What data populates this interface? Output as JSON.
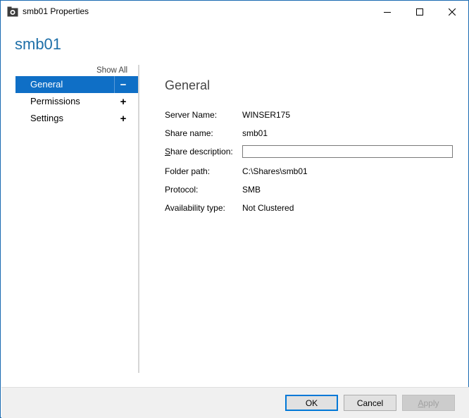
{
  "window": {
    "title": "smb01 Properties"
  },
  "header": {
    "title": "smb01"
  },
  "nav": {
    "show_all": "Show All",
    "items": [
      {
        "label": "General",
        "toggle": "−",
        "selected": true
      },
      {
        "label": "Permissions",
        "toggle": "+",
        "selected": false
      },
      {
        "label": "Settings",
        "toggle": "+",
        "selected": false
      }
    ]
  },
  "general": {
    "section_title": "General",
    "fields": {
      "server_name": {
        "label": "Server Name:",
        "value": "WINSER175"
      },
      "share_name": {
        "label": "Share name:",
        "value": "smb01"
      },
      "share_description": {
        "label_prefix": "S",
        "label_rest": "hare description:",
        "value": ""
      },
      "folder_path": {
        "label": "Folder path:",
        "value": "C:\\Shares\\smb01"
      },
      "protocol": {
        "label": "Protocol:",
        "value": "SMB"
      },
      "availability_type": {
        "label": "Availability type:",
        "value": "Not Clustered"
      }
    }
  },
  "footer": {
    "ok_label": "OK",
    "cancel_label": "Cancel",
    "apply_label_prefix": "A",
    "apply_label_rest": "pply"
  },
  "colors": {
    "accent": "#0f6fc6",
    "header_text": "#1e6fa8",
    "window_border": "#1a6ab1"
  },
  "icons": {
    "app": "share-folder-icon",
    "minimize": "minimize-icon",
    "maximize": "maximize-icon",
    "close": "close-icon"
  }
}
